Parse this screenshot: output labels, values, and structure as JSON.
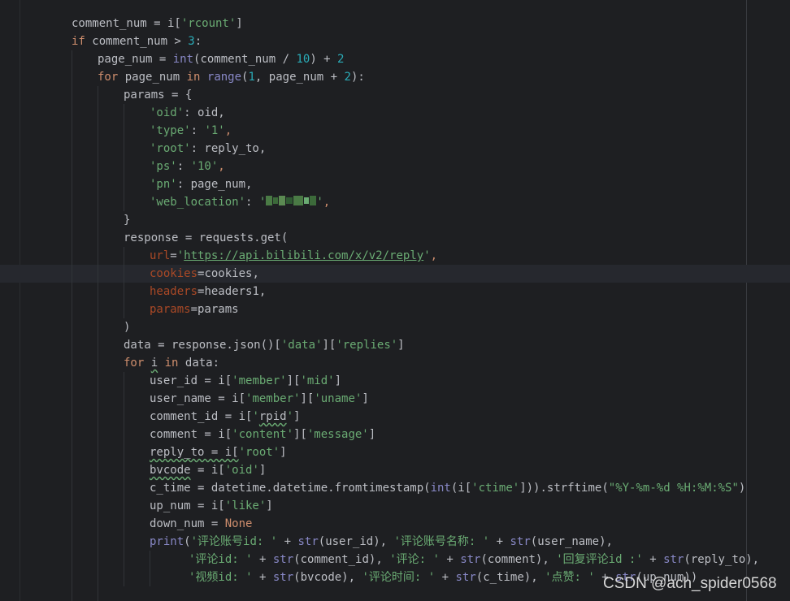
{
  "editor": {
    "lines": [
      {
        "indent": 88,
        "tokens": [
          {
            "t": "comment_num = i[",
            "c": "plain"
          },
          {
            "t": "'rcount'",
            "c": "str"
          },
          {
            "t": "]",
            "c": "plain"
          }
        ]
      },
      {
        "indent": 88,
        "tokens": [
          {
            "t": "if",
            "c": "kw"
          },
          {
            "t": " comment_num > ",
            "c": "plain"
          },
          {
            "t": "3",
            "c": "num"
          },
          {
            "t": ":",
            "c": "plain"
          }
        ]
      },
      {
        "indent": 120,
        "tokens": [
          {
            "t": "page_num = ",
            "c": "plain"
          },
          {
            "t": "int",
            "c": "bi"
          },
          {
            "t": "(comment_num / ",
            "c": "plain"
          },
          {
            "t": "10",
            "c": "num"
          },
          {
            "t": ") + ",
            "c": "plain"
          },
          {
            "t": "2",
            "c": "num"
          }
        ]
      },
      {
        "indent": 120,
        "tokens": [
          {
            "t": "for",
            "c": "kw"
          },
          {
            "t": " page_num ",
            "c": "plain"
          },
          {
            "t": "in",
            "c": "kw"
          },
          {
            "t": " ",
            "c": "plain"
          },
          {
            "t": "range",
            "c": "bi"
          },
          {
            "t": "(",
            "c": "plain"
          },
          {
            "t": "1",
            "c": "num"
          },
          {
            "t": ", page_num + ",
            "c": "plain"
          },
          {
            "t": "2",
            "c": "num"
          },
          {
            "t": "):",
            "c": "plain"
          }
        ]
      },
      {
        "indent": 152,
        "tokens": [
          {
            "t": "params = {",
            "c": "plain"
          }
        ]
      },
      {
        "indent": 184,
        "tokens": [
          {
            "t": "'oid'",
            "c": "str"
          },
          {
            "t": ": oid,",
            "c": "plain"
          }
        ]
      },
      {
        "indent": 184,
        "tokens": [
          {
            "t": "'type'",
            "c": "str"
          },
          {
            "t": ": ",
            "c": "plain"
          },
          {
            "t": "'1'",
            "c": "str"
          },
          {
            "t": ",",
            "c": "kw"
          }
        ]
      },
      {
        "indent": 184,
        "tokens": [
          {
            "t": "'root'",
            "c": "str"
          },
          {
            "t": ": reply_to,",
            "c": "plain"
          }
        ]
      },
      {
        "indent": 184,
        "tokens": [
          {
            "t": "'ps'",
            "c": "str"
          },
          {
            "t": ": ",
            "c": "plain"
          },
          {
            "t": "'10'",
            "c": "str"
          },
          {
            "t": ",",
            "c": "kw"
          }
        ]
      },
      {
        "indent": 184,
        "tokens": [
          {
            "t": "'pn'",
            "c": "str"
          },
          {
            "t": ": page_num,",
            "c": "plain"
          }
        ]
      },
      {
        "indent": 184,
        "tokens": [
          {
            "t": "'web_location'",
            "c": "str"
          },
          {
            "t": ": ",
            "c": "plain"
          },
          {
            "t": "'",
            "c": "str"
          },
          {
            "t": "",
            "c": "pixel"
          },
          {
            "t": "'",
            "c": "str"
          },
          {
            "t": ",",
            "c": "kw"
          }
        ]
      },
      {
        "indent": 152,
        "tokens": [
          {
            "t": "}",
            "c": "plain"
          }
        ]
      },
      {
        "indent": 152,
        "tokens": [
          {
            "t": "response = requests.get(",
            "c": "plain"
          }
        ]
      },
      {
        "indent": 184,
        "tokens": [
          {
            "t": "url",
            "c": "param"
          },
          {
            "t": "=",
            "c": "plain"
          },
          {
            "t": "'",
            "c": "str"
          },
          {
            "t": "https://api.bilibili.com/x/v2/reply",
            "c": "url"
          },
          {
            "t": "'",
            "c": "str"
          },
          {
            "t": ",",
            "c": "kw"
          }
        ]
      },
      {
        "indent": 184,
        "tokens": [
          {
            "t": "cookies",
            "c": "param"
          },
          {
            "t": "=cookies,",
            "c": "plain"
          }
        ]
      },
      {
        "indent": 184,
        "tokens": [
          {
            "t": "headers",
            "c": "param"
          },
          {
            "t": "=headers1,",
            "c": "plain"
          }
        ]
      },
      {
        "indent": 184,
        "tokens": [
          {
            "t": "params",
            "c": "param"
          },
          {
            "t": "=params",
            "c": "plain"
          }
        ]
      },
      {
        "indent": 152,
        "tokens": [
          {
            "t": ")",
            "c": "plain"
          }
        ]
      },
      {
        "indent": 152,
        "tokens": [
          {
            "t": "data = response.json()[",
            "c": "plain"
          },
          {
            "t": "'data'",
            "c": "str"
          },
          {
            "t": "][",
            "c": "plain"
          },
          {
            "t": "'replies'",
            "c": "str"
          },
          {
            "t": "]",
            "c": "plain"
          }
        ]
      },
      {
        "indent": 152,
        "tokens": [
          {
            "t": "for",
            "c": "kw"
          },
          {
            "t": " ",
            "c": "plain"
          },
          {
            "t": "i",
            "c": "typo"
          },
          {
            "t": " ",
            "c": "plain"
          },
          {
            "t": "in",
            "c": "kw"
          },
          {
            "t": " data:",
            "c": "plain"
          }
        ]
      },
      {
        "indent": 184,
        "tokens": [
          {
            "t": "user_id = i[",
            "c": "plain"
          },
          {
            "t": "'member'",
            "c": "str"
          },
          {
            "t": "][",
            "c": "plain"
          },
          {
            "t": "'mid'",
            "c": "str"
          },
          {
            "t": "]",
            "c": "plain"
          }
        ]
      },
      {
        "indent": 184,
        "tokens": [
          {
            "t": "user_name = i[",
            "c": "plain"
          },
          {
            "t": "'member'",
            "c": "str"
          },
          {
            "t": "][",
            "c": "plain"
          },
          {
            "t": "'uname'",
            "c": "str"
          },
          {
            "t": "]",
            "c": "plain"
          }
        ]
      },
      {
        "indent": 184,
        "tokens": [
          {
            "t": "comment_id = i[",
            "c": "plain"
          },
          {
            "t": "'",
            "c": "str"
          },
          {
            "t": "rpid",
            "c": "typo"
          },
          {
            "t": "'",
            "c": "str"
          },
          {
            "t": "]",
            "c": "plain"
          }
        ]
      },
      {
        "indent": 184,
        "tokens": [
          {
            "t": "comment = i[",
            "c": "plain"
          },
          {
            "t": "'content'",
            "c": "str"
          },
          {
            "t": "][",
            "c": "plain"
          },
          {
            "t": "'message'",
            "c": "str"
          },
          {
            "t": "]",
            "c": "plain"
          }
        ]
      },
      {
        "indent": 184,
        "tokens": [
          {
            "t": "reply_to = i[",
            "c": "typo"
          },
          {
            "t": "'root'",
            "c": "str"
          },
          {
            "t": "]",
            "c": "plain"
          }
        ]
      },
      {
        "indent": 184,
        "tokens": [
          {
            "t": "bvcode",
            "c": "typo"
          },
          {
            "t": " = i[",
            "c": "plain"
          },
          {
            "t": "'oid'",
            "c": "str"
          },
          {
            "t": "]",
            "c": "plain"
          }
        ]
      },
      {
        "indent": 184,
        "tokens": [
          {
            "t": "c_time = datetime.datetime.fromtimestamp(",
            "c": "plain"
          },
          {
            "t": "int",
            "c": "bi"
          },
          {
            "t": "(i[",
            "c": "plain"
          },
          {
            "t": "'ctime'",
            "c": "str"
          },
          {
            "t": "])).strftime(",
            "c": "plain"
          },
          {
            "t": "\"%Y-%m-%d %H:%M:%S\"",
            "c": "str"
          },
          {
            "t": ")",
            "c": "plain"
          }
        ]
      },
      {
        "indent": 184,
        "tokens": [
          {
            "t": "up_num = i[",
            "c": "plain"
          },
          {
            "t": "'like'",
            "c": "str"
          },
          {
            "t": "]",
            "c": "plain"
          }
        ]
      },
      {
        "indent": 184,
        "tokens": [
          {
            "t": "down_num = ",
            "c": "plain"
          },
          {
            "t": "None",
            "c": "kw"
          }
        ]
      },
      {
        "indent": 184,
        "tokens": [
          {
            "t": "print",
            "c": "bi"
          },
          {
            "t": "(",
            "c": "plain"
          },
          {
            "t": "'评论账号id: '",
            "c": "str"
          },
          {
            "t": " + ",
            "c": "plain"
          },
          {
            "t": "str",
            "c": "bi"
          },
          {
            "t": "(user_id), ",
            "c": "plain"
          },
          {
            "t": "'评论账号名称: '",
            "c": "str"
          },
          {
            "t": " + ",
            "c": "plain"
          },
          {
            "t": "str",
            "c": "bi"
          },
          {
            "t": "(user_name),",
            "c": "plain"
          }
        ]
      },
      {
        "indent": 232,
        "tokens": [
          {
            "t": "'评论id: '",
            "c": "str"
          },
          {
            "t": " + ",
            "c": "plain"
          },
          {
            "t": "str",
            "c": "bi"
          },
          {
            "t": "(comment_id), ",
            "c": "plain"
          },
          {
            "t": "'评论: '",
            "c": "str"
          },
          {
            "t": " + ",
            "c": "plain"
          },
          {
            "t": "str",
            "c": "bi"
          },
          {
            "t": "(comment), ",
            "c": "plain"
          },
          {
            "t": "'回复评论id :'",
            "c": "str"
          },
          {
            "t": " + ",
            "c": "plain"
          },
          {
            "t": "str",
            "c": "bi"
          },
          {
            "t": "(reply_to),",
            "c": "plain"
          }
        ]
      },
      {
        "indent": 232,
        "tokens": [
          {
            "t": "'视频id: '",
            "c": "str"
          },
          {
            "t": " + ",
            "c": "plain"
          },
          {
            "t": "str",
            "c": "bi"
          },
          {
            "t": "(bvcode), ",
            "c": "plain"
          },
          {
            "t": "'评论时间: '",
            "c": "str"
          },
          {
            "t": " + ",
            "c": "plain"
          },
          {
            "t": "str",
            "c": "bi"
          },
          {
            "t": "(c_time), ",
            "c": "plain"
          },
          {
            "t": "'点赞: '",
            "c": "str"
          },
          {
            "t": " + ",
            "c": "plain"
          },
          {
            "t": "str",
            "c": "bi"
          },
          {
            "t": "(up_num))",
            "c": "plain"
          }
        ]
      }
    ]
  },
  "watermark": "CSDN @ach_spider0568",
  "colors": {
    "background": "#1e1f22",
    "keyword": "#cf8e6d",
    "string": "#6aab73",
    "number": "#2aacb8",
    "builtin": "#8888c6",
    "parameter": "#aa4926",
    "text": "#bcbec4"
  }
}
